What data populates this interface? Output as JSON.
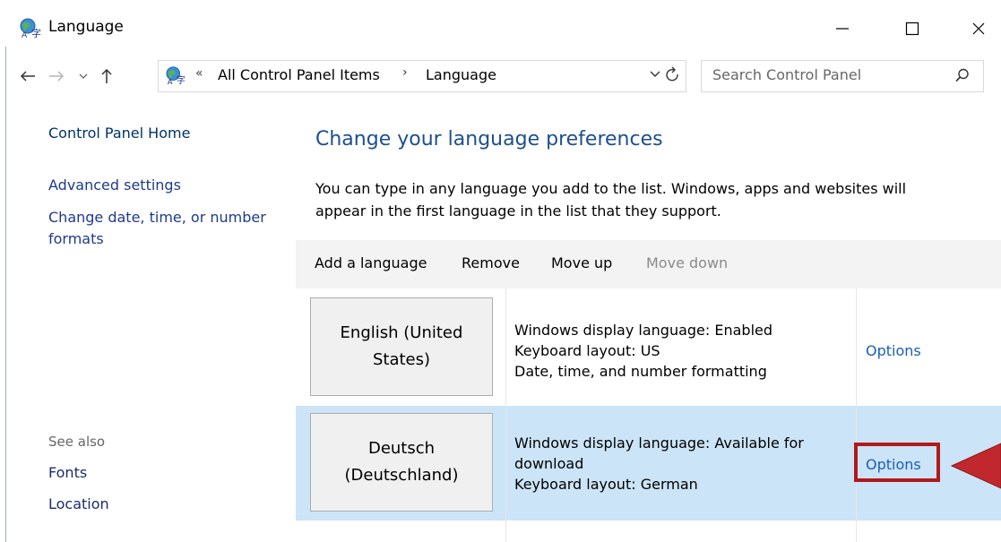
{
  "window": {
    "title": "Language",
    "controls": {
      "minimize": "—",
      "maximize": "☐",
      "close": "✕"
    }
  },
  "address_bar": {
    "overflow": "«",
    "crumb1": "All Control Panel Items",
    "separator": "›",
    "crumb2": "Language"
  },
  "search": {
    "placeholder": "Search Control Panel"
  },
  "sidebar": {
    "home": "Control Panel Home",
    "advanced": "Advanced settings",
    "date_line1": "Change date, time, or number",
    "date_line2": "formats",
    "see_also": "See also",
    "fonts": "Fonts",
    "location": "Location"
  },
  "main": {
    "title": "Change your language preferences",
    "desc_line1": "You can type in any language you add to the list. Windows, apps and websites will",
    "desc_line2": "appear in the first language in the list that they support."
  },
  "toolbar": {
    "add": "Add a language",
    "remove": "Remove",
    "move_up": "Move up",
    "move_down": "Move down"
  },
  "languages": [
    {
      "name_line1": "English (United",
      "name_line2": "States)",
      "info1": "Windows display language: Enabled",
      "info2": "Keyboard layout: US",
      "info3": "Date, time, and number formatting",
      "options": "Options"
    },
    {
      "name_line1": "Deutsch",
      "name_line2": "(Deutschland)",
      "info1": "Windows display language: Available for",
      "info2": "download",
      "info3": "Keyboard layout: German",
      "options": "Options"
    }
  ],
  "colors": {
    "link": "#1a5fb4",
    "title_blue": "#1e4f8c",
    "selected_row": "#cce4f7",
    "highlight": "#b01a1a"
  }
}
